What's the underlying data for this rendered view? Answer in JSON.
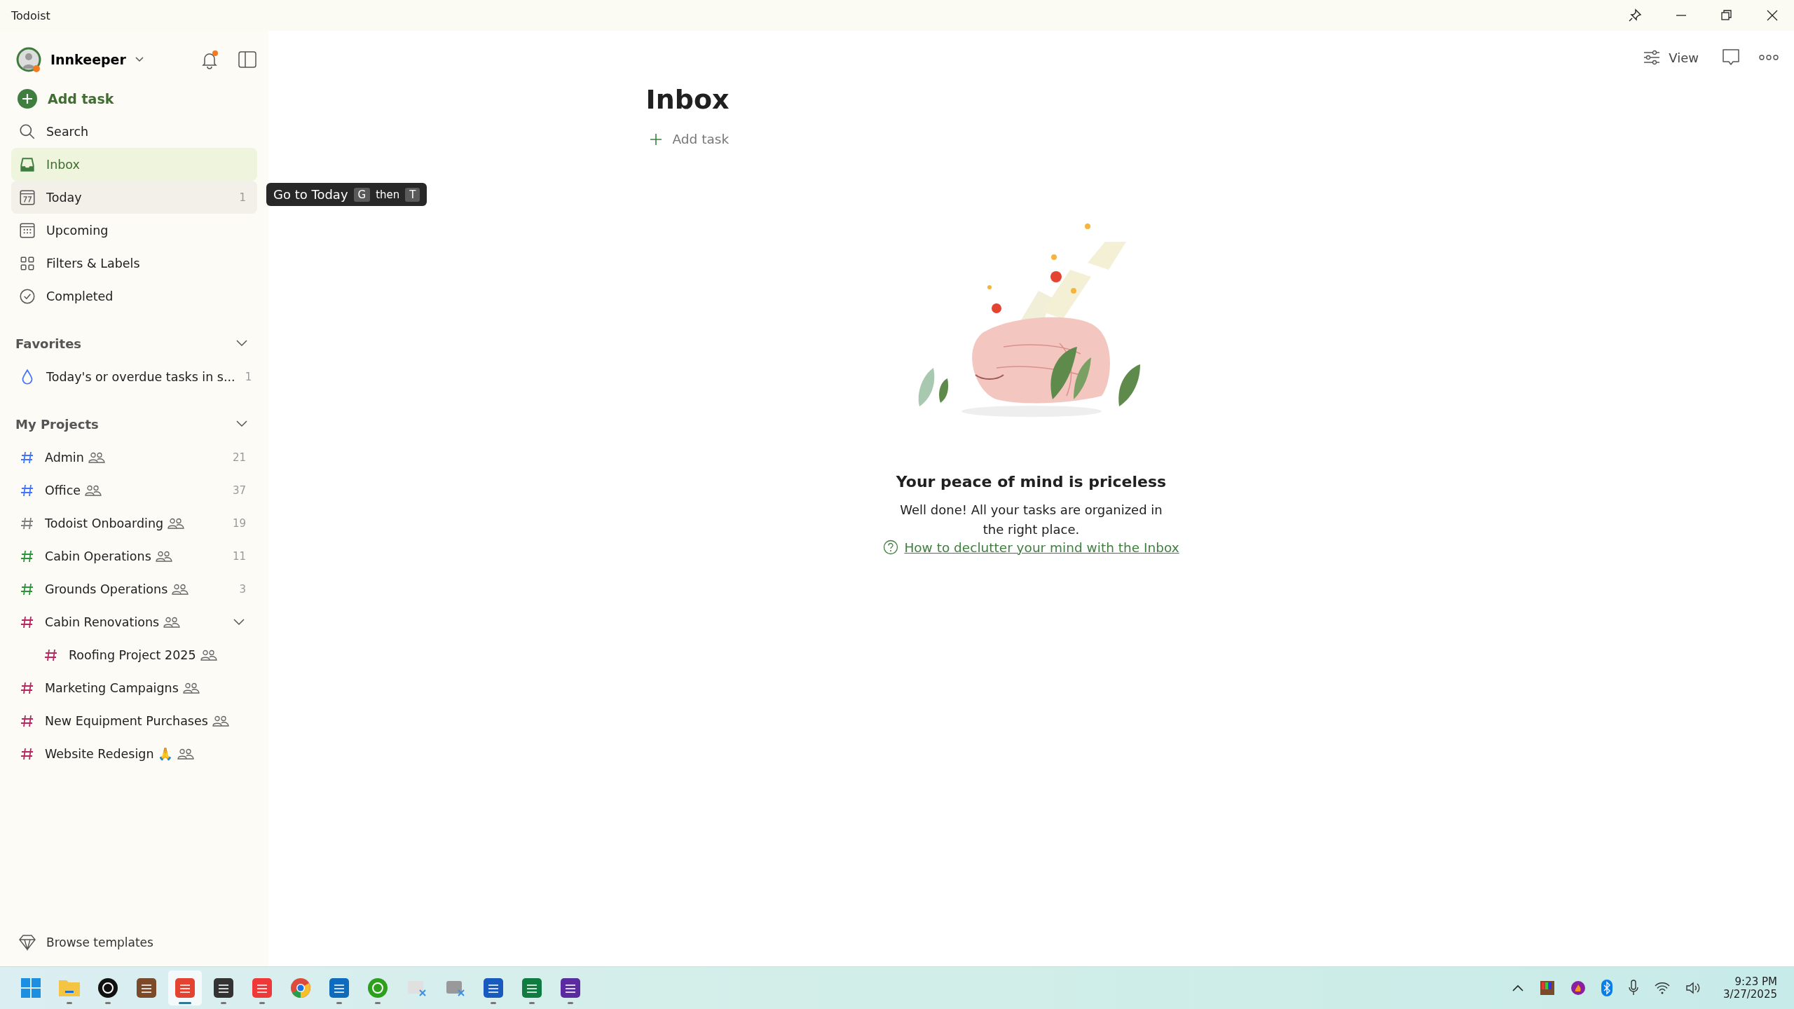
{
  "window": {
    "title": "Todoist"
  },
  "user": {
    "name": "Innkeeper",
    "has_notifications": true
  },
  "add_task_label": "Add task",
  "nav": [
    {
      "kind": "search",
      "label": "Search",
      "selected": false,
      "hovered": false
    },
    {
      "kind": "inbox",
      "label": "Inbox",
      "selected": true,
      "hovered": false
    },
    {
      "kind": "today",
      "label": "Today",
      "count": "1",
      "selected": false,
      "hovered": true
    },
    {
      "kind": "upcoming",
      "label": "Upcoming",
      "selected": false,
      "hovered": false
    },
    {
      "kind": "filters",
      "label": "Filters & Labels",
      "selected": false,
      "hovered": false
    },
    {
      "kind": "completed",
      "label": "Completed",
      "selected": false,
      "hovered": false
    }
  ],
  "tooltip": {
    "text": "Go to Today",
    "keys": [
      "G",
      "then",
      "T"
    ]
  },
  "favorites": {
    "title": "Favorites",
    "expanded": true,
    "items": [
      {
        "label": "Today's or overdue tasks in s...",
        "count": "1"
      }
    ]
  },
  "projects": {
    "title": "My Projects",
    "expanded": true,
    "items": [
      {
        "name": "Admin",
        "color": "#4073ff",
        "shared": true,
        "count": "21"
      },
      {
        "name": "Office",
        "color": "#4073ff",
        "shared": true,
        "count": "37"
      },
      {
        "name": "Todoist Onboarding",
        "color": "#808080",
        "shared": true,
        "count": "19"
      },
      {
        "name": "Cabin Operations",
        "color": "#299438",
        "shared": true,
        "count": "11"
      },
      {
        "name": "Grounds Operations",
        "color": "#299438",
        "shared": true,
        "count": "3"
      },
      {
        "name": "Cabin Renovations",
        "color": "#b8255f",
        "shared": true,
        "expanded": true,
        "children": [
          {
            "name": "Roofing Project 2025",
            "color": "#b8255f",
            "shared": true
          }
        ]
      },
      {
        "name": "Marketing Campaigns",
        "color": "#b8255f",
        "shared": true
      },
      {
        "name": "New Equipment Purchases",
        "color": "#b8255f",
        "shared": true
      },
      {
        "name": "Website Redesign 🙏",
        "color": "#b8255f",
        "shared": true
      }
    ]
  },
  "browse_templates": "Browse templates",
  "main": {
    "title": "Inbox",
    "add_task": "Add task",
    "view_label": "View",
    "empty_state": {
      "heading": "Your peace of mind is priceless",
      "body": "Well done! All your tasks are organized in the right place.",
      "link": "How to declutter your mind with the Inbox"
    }
  },
  "taskbar": {
    "apps": [
      {
        "kind": "start",
        "running": false,
        "selected": false
      },
      {
        "kind": "folder",
        "running": true,
        "selected": false
      },
      {
        "kind": "k",
        "running": true,
        "selected": false
      },
      {
        "kind": "toys",
        "running": false,
        "selected": false
      },
      {
        "kind": "todoist",
        "running": true,
        "selected": true
      },
      {
        "kind": "s",
        "running": true,
        "selected": false
      },
      {
        "kind": "vivaldi",
        "running": true,
        "selected": false
      },
      {
        "kind": "chrome",
        "running": false,
        "selected": false
      },
      {
        "kind": "outlook",
        "running": true,
        "selected": false
      },
      {
        "kind": "qb",
        "running": true,
        "selected": false
      },
      {
        "kind": "snip",
        "running": false,
        "selected": false
      },
      {
        "kind": "fax",
        "running": false,
        "selected": false
      },
      {
        "kind": "word",
        "running": true,
        "selected": false
      },
      {
        "kind": "excel",
        "running": true,
        "selected": false
      },
      {
        "kind": "g",
        "running": true,
        "selected": false
      }
    ],
    "time": "9:23 PM",
    "date": "3/27/2025"
  }
}
